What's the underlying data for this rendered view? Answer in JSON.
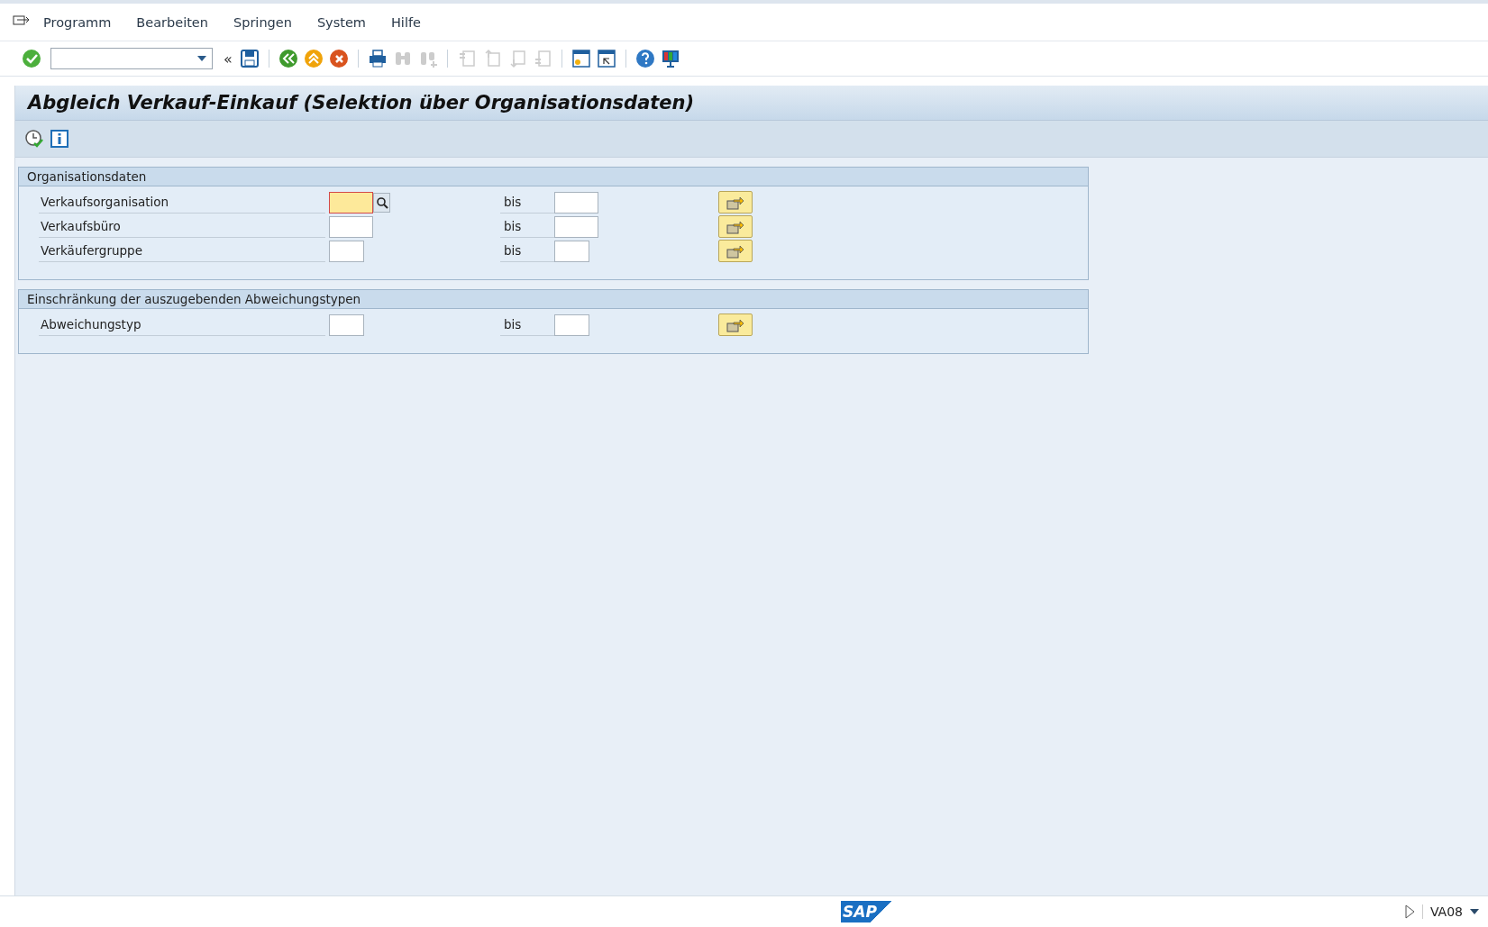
{
  "menu": [
    {
      "label": "Programm"
    },
    {
      "label": "Bearbeiten"
    },
    {
      "label": "Springen"
    },
    {
      "label": "System"
    },
    {
      "label": "Hilfe"
    }
  ],
  "toolbar": [
    {
      "kind": "enter",
      "disabled": false
    },
    {
      "kind": "command"
    },
    {
      "kind": "collapse",
      "text": "«"
    },
    {
      "kind": "save",
      "disabled": false
    },
    {
      "kind": "sep"
    },
    {
      "kind": "back",
      "disabled": false
    },
    {
      "kind": "exit",
      "disabled": false
    },
    {
      "kind": "cancel",
      "disabled": false
    },
    {
      "kind": "sep"
    },
    {
      "kind": "print",
      "disabled": false
    },
    {
      "kind": "find",
      "disabled": true
    },
    {
      "kind": "findnext",
      "disabled": true
    },
    {
      "kind": "sep"
    },
    {
      "kind": "first",
      "disabled": true
    },
    {
      "kind": "prev",
      "disabled": true
    },
    {
      "kind": "next",
      "disabled": true
    },
    {
      "kind": "last",
      "disabled": true
    },
    {
      "kind": "sep"
    },
    {
      "kind": "newsession",
      "disabled": false
    },
    {
      "kind": "shortcut",
      "disabled": false
    },
    {
      "kind": "sep"
    },
    {
      "kind": "help",
      "disabled": false
    },
    {
      "kind": "layout",
      "disabled": false
    }
  ],
  "title": "Abgleich Verkauf-Einkauf (Selektion über Organisationsdaten)",
  "app_toolbar": [
    {
      "kind": "execute"
    },
    {
      "kind": "info"
    }
  ],
  "groups": [
    {
      "title": "Organisationsdaten",
      "rows": [
        {
          "label": "Verkaufsorganisation",
          "low": {
            "kind": "long",
            "focused": true
          },
          "to": "bis",
          "high": {
            "kind": "long"
          }
        },
        {
          "label": "Verkaufsbüro",
          "low": {
            "kind": "long",
            "focused": false
          },
          "to": "bis",
          "high": {
            "kind": "long"
          }
        },
        {
          "label": "Verkäufergruppe",
          "low": {
            "kind": "short",
            "focused": false
          },
          "to": "bis",
          "high": {
            "kind": "short"
          }
        }
      ]
    },
    {
      "title": "Einschränkung der auszugebenden Abweichungstypen",
      "rows": [
        {
          "label": "Abweichungstyp",
          "low": {
            "kind": "short",
            "focused": false
          },
          "to": "bis",
          "high": {
            "kind": "short"
          }
        }
      ]
    }
  ],
  "status_bar": {
    "logo": "SAP",
    "transaction": "VA08"
  }
}
